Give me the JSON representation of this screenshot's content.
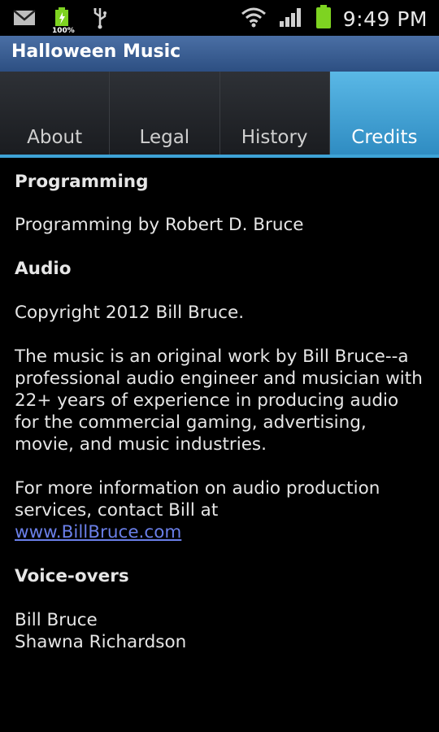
{
  "status_bar": {
    "battery_percent_label": "100%",
    "time": "9:49 PM",
    "icons": [
      "mail-icon",
      "battery-charging-icon",
      "usb-icon",
      "wifi-icon",
      "signal-icon",
      "battery-icon"
    ]
  },
  "app": {
    "title": "Halloween Music"
  },
  "tabs": [
    {
      "label": "About",
      "active": false
    },
    {
      "label": "Legal",
      "active": false
    },
    {
      "label": "History",
      "active": false
    },
    {
      "label": "Credits",
      "active": true
    }
  ],
  "credits": {
    "programming_heading": "Programming",
    "programming_text": "Programming by Robert D. Bruce",
    "audio_heading": "Audio",
    "audio_copyright": "Copyright 2012 Bill Bruce.",
    "audio_description": "The music is an original work by Bill Bruce--a professional audio engineer and musician with 22+ years of experience in producing audio for the commercial gaming, advertising, movie, and music industries.",
    "audio_contact": "For more information on audio production services, contact Bill at",
    "audio_link": "www.BillBruce.com",
    "voiceovers_heading": "Voice-overs",
    "voiceover_1": "Bill Bruce",
    "voiceover_2": "Shawna Richardson"
  },
  "colors": {
    "tab_active": "#3ea3d6",
    "titlebar": "#3d6296",
    "link": "#6a7fe8"
  }
}
